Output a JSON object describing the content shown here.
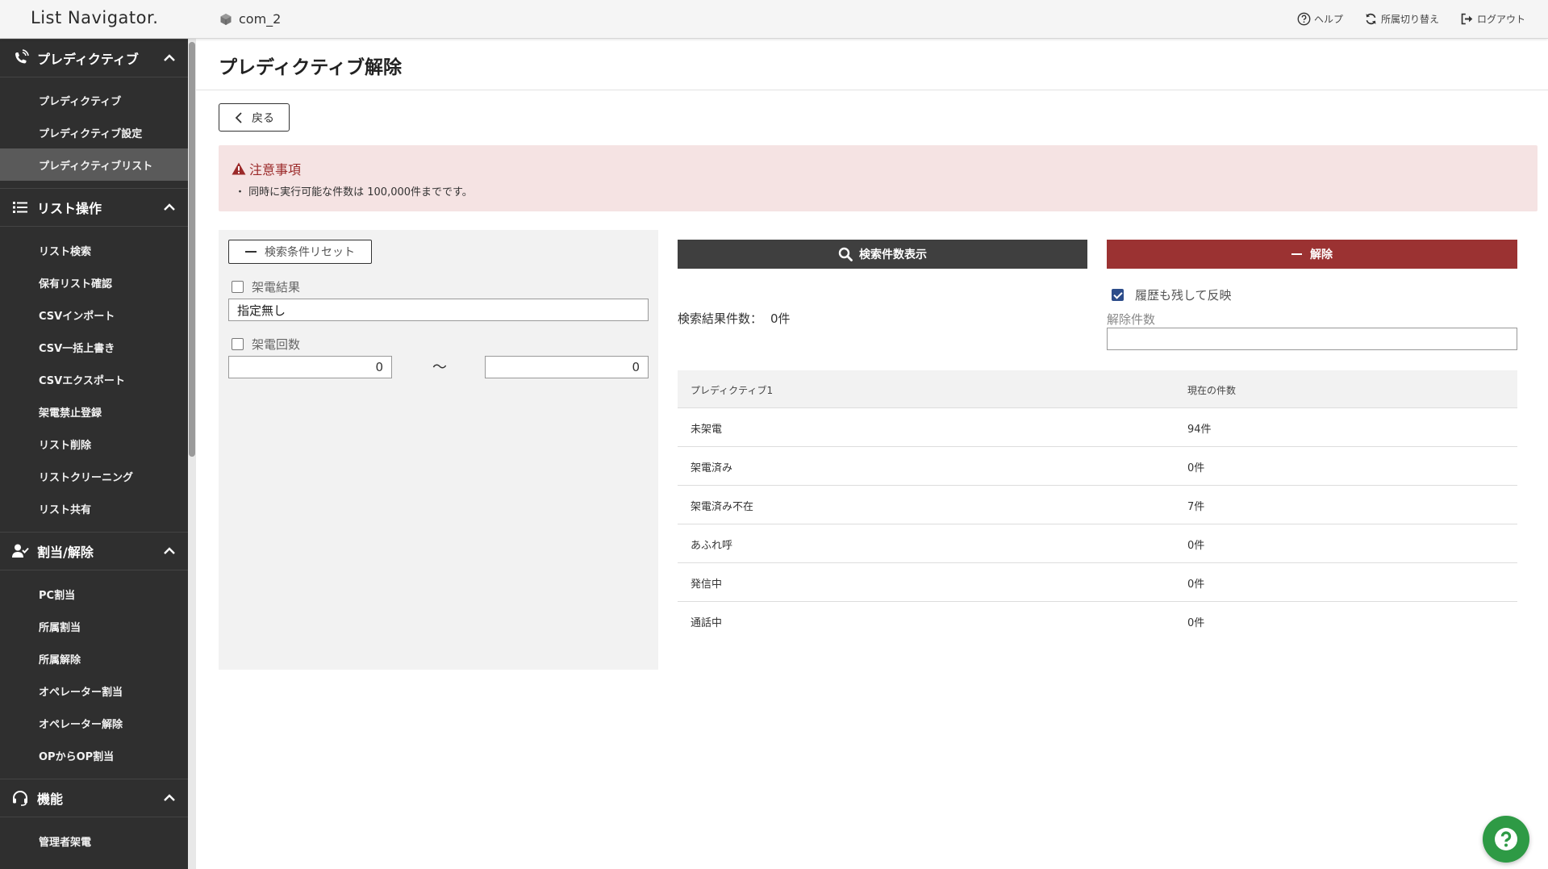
{
  "header": {
    "logo": "List Navigator.",
    "company": "com_2",
    "help": "ヘルプ",
    "switch": "所属切り替え",
    "logout": "ログアウト"
  },
  "sidebar": {
    "sections": [
      {
        "label": "プレディクティブ",
        "icon": "phone-wave-icon",
        "items": [
          "プレディクティブ",
          "プレディクティブ設定",
          "プレディクティブリスト"
        ]
      },
      {
        "label": "リスト操作",
        "icon": "list-icon",
        "items": [
          "リスト検索",
          "保有リスト確認",
          "CSVインポート",
          "CSV一括上書き",
          "CSVエクスポート",
          "架電禁止登録",
          "リスト削除",
          "リストクリーニング",
          "リスト共有"
        ]
      },
      {
        "label": "割当/解除",
        "icon": "user-check-icon",
        "items": [
          "PC割当",
          "所属割当",
          "所属解除",
          "オペレーター割当",
          "オペレーター解除",
          "OPからOP割当"
        ]
      },
      {
        "label": "機能",
        "icon": "headset-icon",
        "items": [
          "管理者架電"
        ]
      }
    ],
    "active_item": "プレディクティブリスト"
  },
  "main": {
    "title": "プレディクティブ解除",
    "back_label": "戻る",
    "notice": {
      "title": "注意事項",
      "text": "・ 同時に実行可能な件数は 100,000件までです。"
    },
    "filter": {
      "reset_label": "検索条件リセット",
      "call_result_label": "架電結果",
      "call_result_value": "指定無し",
      "call_count_label": "架電回数",
      "count_from": "0",
      "count_to": "0",
      "tilde": "〜"
    },
    "search_label": "検索件数表示",
    "release_label": "解除",
    "history_label": "履歴も残して反映",
    "history_checked": true,
    "release_count_label": "解除件数",
    "result_count_label": "検索結果件数：",
    "result_count_value": "0件",
    "table": {
      "headers": [
        "プレディクティブ1",
        "現在の件数"
      ],
      "rows": [
        [
          "未架電",
          "94件"
        ],
        [
          "架電済み",
          "0件"
        ],
        [
          "架電済み不在",
          "7件"
        ],
        [
          "あふれ呼",
          "0件"
        ],
        [
          "発信中",
          "0件"
        ],
        [
          "通話中",
          "0件"
        ]
      ]
    }
  },
  "colors": {
    "sidebar_bg": "#2f2f2f",
    "active_item_bg": "#5a5a5a",
    "notice_bg": "#f5e3e3",
    "notice_title": "#9b2a2a",
    "search_btn": "#3f3f3f",
    "release_btn": "#9b3232",
    "help_fab": "#2e9a45"
  }
}
